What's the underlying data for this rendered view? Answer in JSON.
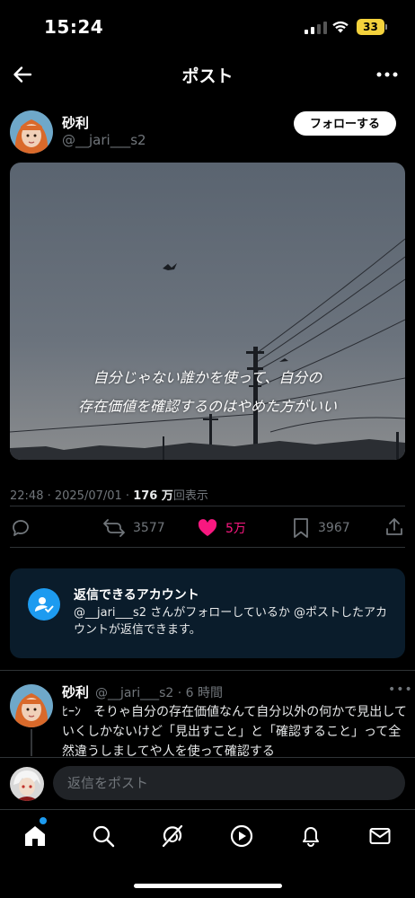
{
  "status_bar": {
    "time": "15:24",
    "battery": "33"
  },
  "nav": {
    "title": "ポスト",
    "back_icon": "arrow-left-icon",
    "more_icon": "more-horizontal-icon"
  },
  "post": {
    "author_name": "砂利",
    "author_handle": "@__jari___s2",
    "follow_label": "フォローする",
    "image_caption_line1": "自分じゃない誰かを使って、自分の",
    "image_caption_line2": "存在価値を確認するのはやめた方がいい",
    "time": "22:48 · 2025/07/01 · ",
    "views_count": "176 万",
    "views_label": "回表示"
  },
  "actions": {
    "reposts": "3577",
    "likes": "5万",
    "bookmarks": "3967",
    "like_color": "#f91880"
  },
  "reply_restriction": {
    "title": "返信できるアカウント",
    "body": "@__jari___s2 さんがフォローしているか @ポストしたアカウントが返信できます。"
  },
  "reply": {
    "author_name": "砂利",
    "meta": "@__jari___s2 · 6 時間",
    "text": "ﾋｰﾝ　そりゃ自分の存在価値なんて自分以外の何かで見出していくしかないけど「見出すこと」と「確認すること」って全然違うしましてや人を使って確認する"
  },
  "compose": {
    "placeholder": "返信をポスト"
  },
  "tabs": [
    "home-icon",
    "search-icon",
    "grok-icon",
    "video-icon",
    "notifications-icon",
    "messages-icon"
  ]
}
